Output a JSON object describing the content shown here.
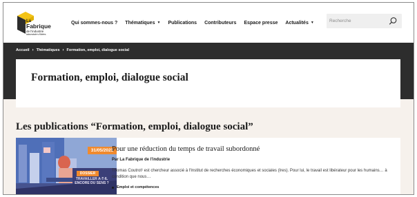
{
  "header": {
    "logo": {
      "line1": "La",
      "line2": "Fabrique",
      "line3": "de l'industrie",
      "line4": "laboratoire d'idées"
    },
    "nav": [
      {
        "label": "Qui sommes-nous ?",
        "has_dropdown": false
      },
      {
        "label": "Thématiques",
        "has_dropdown": true
      },
      {
        "label": "Publications",
        "has_dropdown": false
      },
      {
        "label": "Contributeurs",
        "has_dropdown": false
      },
      {
        "label": "Espace presse",
        "has_dropdown": false
      },
      {
        "label": "Actualités",
        "has_dropdown": true
      }
    ],
    "search": {
      "placeholder": "Recherche",
      "value": "",
      "icon": "search-icon"
    },
    "dropdown_caret": "▼"
  },
  "breadcrumb": {
    "items": [
      "Accueil",
      "Thématiques",
      "Formation, emploi, dialogue social"
    ],
    "separator": "›"
  },
  "page": {
    "title": "Formation, emploi, dialogue social",
    "section_title": "Les publications “Formation, emploi, dialogue social”"
  },
  "publication": {
    "date": "31/05/2023",
    "thumb_tag": "DOSSIER",
    "thumb_text": "TRAVAILLER A-T-IL ENCORE DU SENS ?",
    "title": "Pour une réduction du temps de travail subordonné",
    "author": "Par La Fabrique de l'industrie",
    "excerpt": "Thomas Coutrot¹ est chercheur associé à l'Institut de recherches économiques et sociales (Ires). Pour lui, le travail est libérateur pour les humains… à condition que nous…",
    "tag": "Emploi et compétences"
  },
  "colors": {
    "accent": "#f08a2e",
    "dark_band": "#2d2d2d",
    "content_bg": "#f6f1ec",
    "logo_yellow": "#f3c316"
  }
}
